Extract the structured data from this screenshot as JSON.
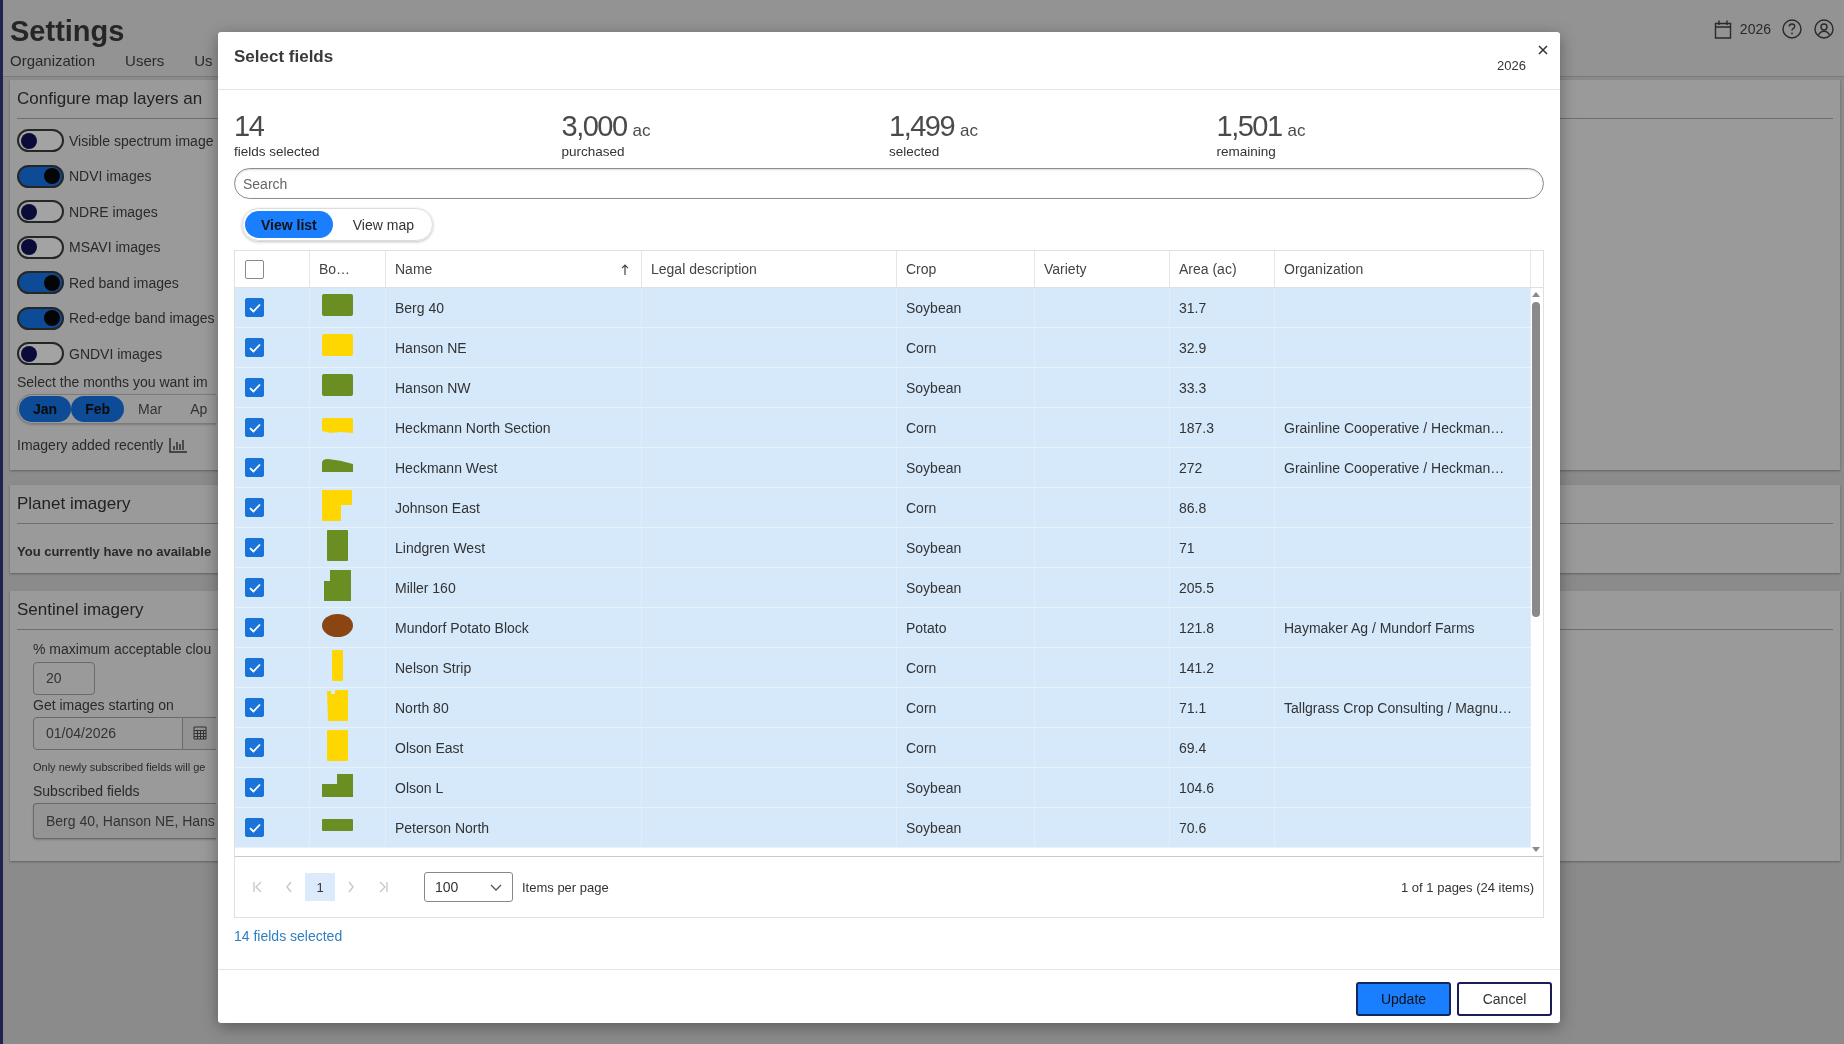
{
  "page": {
    "title": "Settings",
    "tabs": [
      {
        "label": "Organization"
      },
      {
        "label": "Users"
      },
      {
        "label": "Us"
      }
    ],
    "year": "2026"
  },
  "map_layers": {
    "title": "Configure map layers an",
    "toggles": [
      {
        "label": "Visible spectrum image",
        "on": false
      },
      {
        "label": "NDVI images",
        "on": true
      },
      {
        "label": "NDRE images",
        "on": false
      },
      {
        "label": "MSAVI images",
        "on": false
      },
      {
        "label": "Red band images",
        "on": true
      },
      {
        "label": "Red-edge band images",
        "on": true
      },
      {
        "label": "GNDVI images",
        "on": false
      }
    ],
    "months_prompt": "Select the months you want im",
    "months": [
      {
        "label": "Jan",
        "selected": true
      },
      {
        "label": "Feb",
        "selected": true
      },
      {
        "label": "Mar",
        "selected": false
      },
      {
        "label": "Ap",
        "selected": false
      }
    ],
    "recent_label": "Imagery added recently"
  },
  "planet": {
    "title": "Planet imagery",
    "message": "You currently have no available"
  },
  "sentinel": {
    "title": "Sentinel imagery",
    "cloud_label": "% maximum acceptable clou",
    "cloud_value": "20",
    "start_label": "Get images starting on",
    "start_value": "01/04/2026",
    "note": "Only newly subscribed fields will ge",
    "subscribed_label": "Subscribed fields",
    "subscribed_value": "Berg 40, Hanson NE, Hans"
  },
  "dialog": {
    "title": "Select fields",
    "year": "2026",
    "stats": [
      {
        "value": "14",
        "label": "fields selected"
      },
      {
        "value": "3,000",
        "unit": "ac",
        "label": "purchased"
      },
      {
        "value": "1,499",
        "unit": "ac",
        "label": "selected"
      },
      {
        "value": "1,501",
        "unit": "ac",
        "label": "remaining"
      }
    ],
    "search": {
      "placeholder": "Search"
    },
    "views": [
      {
        "label": "View list",
        "selected": true
      },
      {
        "label": "View map",
        "selected": false
      }
    ],
    "table": {
      "header_checked": false,
      "columns": [
        {
          "label": "Bo…",
          "sorted": false
        },
        {
          "label": "Name",
          "sorted": true
        },
        {
          "label": "Legal description",
          "sorted": false
        },
        {
          "label": "Crop",
          "sorted": false
        },
        {
          "label": "Variety",
          "sorted": false
        },
        {
          "label": "Area (ac)",
          "sorted": false
        },
        {
          "label": "Organization",
          "sorted": false
        }
      ],
      "rows": [
        {
          "selected": true,
          "boundary": {
            "kind": "square",
            "color": "#6b8e23"
          },
          "name": "Berg 40",
          "crop": "Soybean",
          "area": "31.7"
        },
        {
          "selected": true,
          "boundary": {
            "kind": "square",
            "color": "#ffd700"
          },
          "name": "Hanson NE",
          "crop": "Corn",
          "area": "32.9"
        },
        {
          "selected": true,
          "boundary": {
            "kind": "square",
            "color": "#6b8e23"
          },
          "name": "Hanson NW",
          "crop": "Soybean",
          "area": "33.3"
        },
        {
          "selected": true,
          "boundary": {
            "kind": "wide-strip",
            "color": "#ffd700"
          },
          "name": "Heckmann North Section",
          "crop": "Corn",
          "area": "187.3",
          "organization": "Grainline Cooperative / Heckman…"
        },
        {
          "selected": true,
          "boundary": {
            "kind": "wedge",
            "color": "#6b8e23"
          },
          "name": "Heckmann West",
          "crop": "Soybean",
          "area": "272",
          "organization": "Grainline Cooperative / Heckman…"
        },
        {
          "selected": true,
          "boundary": {
            "kind": "notched",
            "color": "#ffd700"
          },
          "name": "Johnson East",
          "crop": "Corn",
          "area": "86.8"
        },
        {
          "selected": true,
          "boundary": {
            "kind": "tall",
            "color": "#6b8e23"
          },
          "name": "Lindgren West",
          "crop": "Soybean",
          "area": "71"
        },
        {
          "selected": true,
          "boundary": {
            "kind": "stepped",
            "color": "#6b8e23"
          },
          "name": "Miller 160",
          "crop": "Soybean",
          "area": "205.5"
        },
        {
          "selected": true,
          "boundary": {
            "kind": "oval",
            "color": "#8b4513"
          },
          "name": "Mundorf Potato Block",
          "crop": "Potato",
          "area": "121.8",
          "organization": "Haymaker Ag / Mundorf Farms"
        },
        {
          "selected": true,
          "boundary": {
            "kind": "narrow-strip",
            "color": "#ffd700"
          },
          "name": "Nelson Strip",
          "crop": "Corn",
          "area": "141.2"
        },
        {
          "selected": true,
          "boundary": {
            "kind": "notched-top",
            "color": "#ffd700"
          },
          "name": "North 80",
          "crop": "Corn",
          "area": "71.1",
          "organization": "Tallgrass Crop Consulting / Magnu…"
        },
        {
          "selected": true,
          "boundary": {
            "kind": "tall",
            "color": "#ffd700"
          },
          "name": "Olson East",
          "crop": "Corn",
          "area": "69.4"
        },
        {
          "selected": true,
          "boundary": {
            "kind": "l-shape",
            "color": "#6b8e23"
          },
          "name": "Olson L",
          "crop": "Soybean",
          "area": "104.6"
        },
        {
          "selected": true,
          "boundary": {
            "kind": "bar",
            "color": "#6b8e23"
          },
          "name": "Peterson North",
          "crop": "Soybean",
          "area": "70.6"
        }
      ]
    },
    "pager": {
      "nav": [
        {
          "kind": "first",
          "disabled": true
        },
        {
          "kind": "prev",
          "disabled": true
        },
        {
          "kind": "next",
          "disabled": true
        },
        {
          "kind": "last",
          "disabled": true
        }
      ],
      "pages": [
        {
          "label": "1",
          "selected": true
        }
      ],
      "page_size": "100",
      "page_size_label": "Items per page",
      "summary": "1 of 1 pages (24 items)"
    },
    "selection_link": "14 fields selected",
    "buttons": [
      {
        "label": "Update",
        "kind": "primary"
      },
      {
        "label": "Cancel",
        "kind": "secondary"
      }
    ]
  }
}
